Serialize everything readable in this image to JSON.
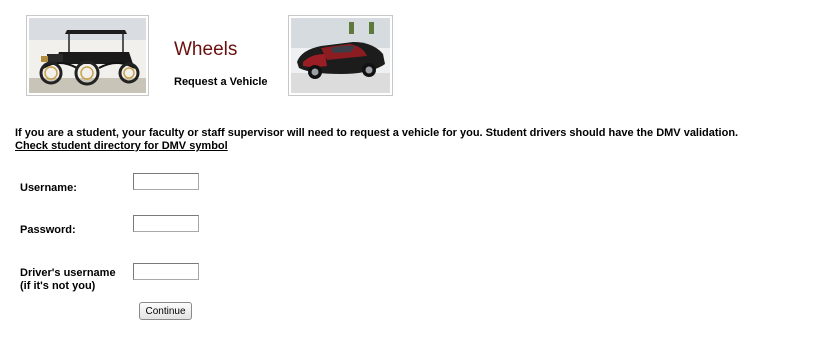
{
  "header": {
    "title": "Wheels",
    "subtitle": "Request a Vehicle",
    "title_color": "#6b0f0f",
    "left_image": "vintage-car-photo",
    "right_image": "sports-car-photo"
  },
  "notice": {
    "text": "If you are a student, your faculty or staff supervisor will need to request a vehicle for you. Student drivers should have the DMV validation.",
    "link_text": "Check student directory for DMV symbol"
  },
  "form": {
    "username": {
      "label": "Username:",
      "value": ""
    },
    "password": {
      "label": "Password:",
      "value": ""
    },
    "driver": {
      "label_line1": "Driver's username",
      "label_line2": "(if it's not you)",
      "value": ""
    },
    "submit_label": "Continue"
  }
}
